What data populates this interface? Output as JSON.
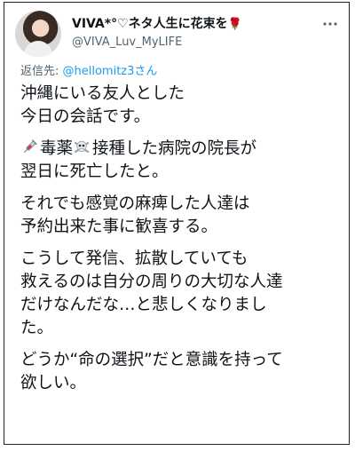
{
  "tweet": {
    "display_name": "VIVA*°♡ネタ人生に花束を",
    "name_emoji": "🌹",
    "handle": "@VIVA_Luv_MyLIFE",
    "reply_prefix": "返信先: ",
    "reply_mention": "@hellomitz3さん",
    "paragraphs": [
      {
        "emoji": "syringe",
        "text": "沖縄にいる友人とした\n今日の会話です。"
      },
      {
        "emoji_icons": [
          "syringe-icon",
          "skull-crossbones-icon"
        ],
        "text_a": "毒薬",
        "text_b": "接種した病院の院長が\n翌日に死亡したと。"
      },
      {
        "text": "それでも感覚の麻痺した人達は\n予約出来た事に歓喜する。"
      },
      {
        "text": "こうして発信、拡散していても\n救えるのは自分の周りの大切な人達\nだけなんだな…と悲しくなりまし\nた。"
      },
      {
        "text": "どうか“命の選択”だと意識を持って\n欲しい。"
      }
    ]
  }
}
